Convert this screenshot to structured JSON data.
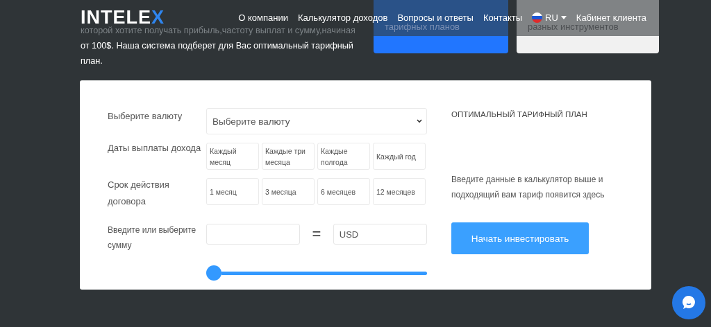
{
  "header": {
    "logo": "INTELEX",
    "nav": [
      {
        "label": "О компании"
      },
      {
        "label": "Калькулятор доходов"
      },
      {
        "label": "Вопросы и ответы"
      },
      {
        "label": "Контакты"
      }
    ],
    "language": "RU",
    "cabinet": "Кабинет клиента"
  },
  "intro": {
    "dimmed_text": "которой хотите получать прибыль,частоту выплат и сумму,начиная",
    "text": "от 100$. Наша система подберет для Вас оптимальный тарифный план."
  },
  "cards": [
    {
      "text": "тарифных планов",
      "kind": "blue"
    },
    {
      "text": "разных инструментов",
      "kind": "grey"
    }
  ],
  "calculator": {
    "currency": {
      "label": "Выберите валюту",
      "placeholder": "Выберите валюту"
    },
    "payout": {
      "label": "Даты выплаты дохода",
      "options": [
        {
          "label": "Каждый месяц",
          "selected": false
        },
        {
          "label": "Каждые три месяца",
          "selected": false
        },
        {
          "label": "Каждые полгода",
          "selected": false
        },
        {
          "label": "Каждый год",
          "selected": false
        }
      ]
    },
    "term": {
      "label": "Срок действия договора",
      "options": [
        {
          "label": "1 месяц",
          "selected": false
        },
        {
          "label": "3 месяца",
          "selected": false
        },
        {
          "label": "6 месяцев",
          "selected": false
        },
        {
          "label": "12 месяцев",
          "selected": false
        }
      ]
    },
    "amount": {
      "label": "Введите или выберите сумму",
      "equals": "=",
      "currency_value": "USD",
      "level": 0
    }
  },
  "result": {
    "title": "ОПТИМАЛЬНЫЙ ТАРИФНЫЙ ПЛАН",
    "description": "Введите данные в калькулятор выше и подходящий вам тариф появится здесь",
    "button": "Начать инвестировать"
  }
}
